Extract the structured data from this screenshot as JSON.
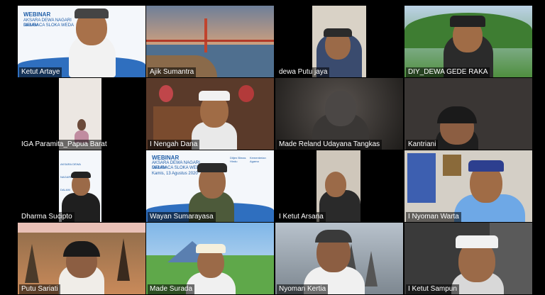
{
  "meeting": {
    "webinar": {
      "label": "WEBINAR",
      "title_line1": "AKSARA DEWA NAGARI DALAM",
      "title_line2": "MEMBACA SLOKA WEDA",
      "date": "Kamis, 13 Agustus 2020",
      "org1": "Ditjen Bimas Hindu",
      "org2": "Kementerian Agama"
    },
    "participants": [
      {
        "name": "Ketut Artaye"
      },
      {
        "name": "Ajik Sumantra"
      },
      {
        "name": "dewa Putu jaya"
      },
      {
        "name": "DIY_DEWA GEDE RAKA"
      },
      {
        "name": "IGA Paramita_Papua Barat"
      },
      {
        "name": "I Nengah Dana"
      },
      {
        "name": "Made Reland Udayana Tangkas"
      },
      {
        "name": "Kantriani"
      },
      {
        "name": "Dharma Sucipto"
      },
      {
        "name": "Wayan Sumarayasa"
      },
      {
        "name": "I Ketut Arsana"
      },
      {
        "name": "I Nyoman Warta"
      },
      {
        "name": "Putu Sariati"
      },
      {
        "name": "Made Surada"
      },
      {
        "name": "Nyoman Kertia"
      },
      {
        "name": "I Ketut Sampun"
      }
    ]
  },
  "colors": {
    "active_border": "#8ed34a",
    "banner_blue": "#1f5ea8"
  }
}
